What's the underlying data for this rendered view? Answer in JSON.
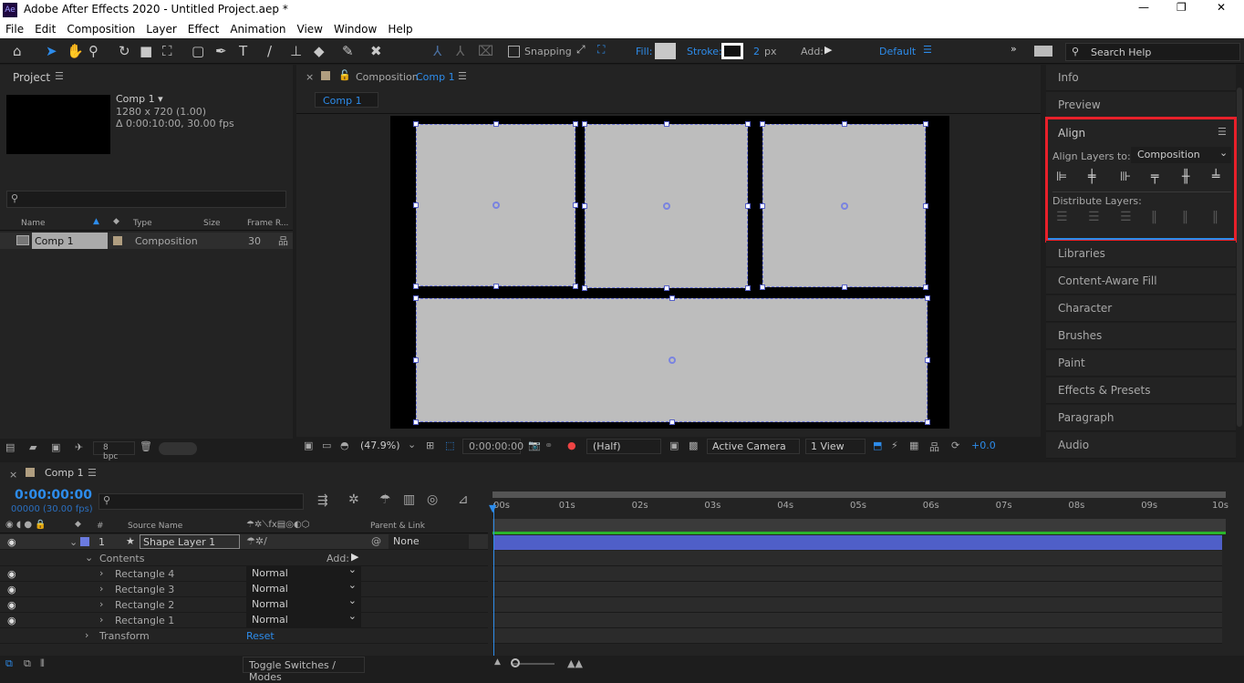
{
  "app": {
    "title": "Adobe After Effects 2020 - Untitled Project.aep *",
    "logo": "Ae"
  },
  "menu": [
    "File",
    "Edit",
    "Composition",
    "Layer",
    "Effect",
    "Animation",
    "View",
    "Window",
    "Help"
  ],
  "toolbar": {
    "snapping": "Snapping",
    "fill": "Fill:",
    "stroke": "Stroke:",
    "stroke_width": "2",
    "stroke_unit": "px",
    "add": "Add:",
    "workspace": "Default",
    "search_placeholder": "Search Help",
    "fill_color": "#c8c8c8"
  },
  "project": {
    "title": "Project",
    "comp_name": "Comp 1 ▾",
    "comp_size": "1280 x 720 (1.00)",
    "comp_duration": "Δ 0:00:10:00, 30.00 fps",
    "columns": [
      "Name",
      "Type",
      "Size",
      "Frame R..."
    ],
    "items": [
      {
        "name": "Comp 1",
        "type": "Composition",
        "size": "",
        "frame_rate": "30"
      }
    ],
    "bpc": "8 bpc"
  },
  "comp": {
    "tab_prefix": "Composition",
    "tab_name": "Comp 1",
    "subtab": "Comp 1",
    "zoom": "(47.9%)",
    "timecode": "0:00:00:00",
    "resolution": "(Half)",
    "camera": "Active Camera",
    "views": "1 View",
    "exposure": "+0.0"
  },
  "right": {
    "panels_top": [
      "Info",
      "Preview"
    ],
    "align": {
      "title": "Align",
      "align_to_label": "Align Layers to:",
      "align_to_value": "Composition",
      "distribute_label": "Distribute Layers:"
    },
    "panels_bottom": [
      "Libraries",
      "Content-Aware Fill",
      "Character",
      "Brushes",
      "Paint",
      "Effects & Presets",
      "Paragraph",
      "Audio"
    ]
  },
  "timeline": {
    "tab": "Comp 1",
    "timecode": "0:00:00:00",
    "frames": "00000 (30.00 fps)",
    "source_name": "Source Name",
    "parent_link": "Parent & Link",
    "ruler": [
      "00s",
      "01s",
      "02s",
      "03s",
      "04s",
      "05s",
      "06s",
      "07s",
      "08s",
      "09s",
      "10s"
    ],
    "layer": {
      "number": "1",
      "name": "Shape Layer 1",
      "parent": "None",
      "label_color": "#6b7be0"
    },
    "contents": "Contents",
    "add": "Add:",
    "rectangles": [
      {
        "name": "Rectangle 4",
        "mode": "Normal"
      },
      {
        "name": "Rectangle 3",
        "mode": "Normal"
      },
      {
        "name": "Rectangle 2",
        "mode": "Normal"
      },
      {
        "name": "Rectangle 1",
        "mode": "Normal"
      }
    ],
    "transform": "Transform",
    "reset": "Reset",
    "toggle": "Toggle Switches / Modes"
  },
  "colors": {
    "accent": "#2d8ceb",
    "highlight": "#e8202a",
    "bar": "#4f5fc8",
    "work_area": "#2ab52a"
  }
}
